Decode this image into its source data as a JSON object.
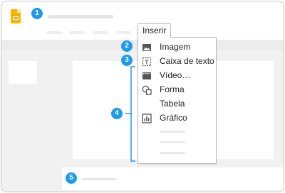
{
  "menu": {
    "open_menu_label": "Inserir",
    "items": [
      {
        "label": "Imagem",
        "icon": "image-icon"
      },
      {
        "label": "Caixa de texto",
        "icon": "text-box-icon"
      },
      {
        "label": "Vídeo…",
        "icon": "video-icon"
      },
      {
        "label": "Forma",
        "icon": "shape-icon"
      },
      {
        "label": "Tabela",
        "icon": ""
      },
      {
        "label": "Gráfico",
        "icon": "chart-icon"
      }
    ]
  },
  "callouts": [
    "1",
    "2",
    "3",
    "4",
    "5"
  ],
  "colors": {
    "callout_blue": "#1e9be9",
    "app_icon_yellow": "#f4b400",
    "background_gray": "#f1f1f1"
  }
}
